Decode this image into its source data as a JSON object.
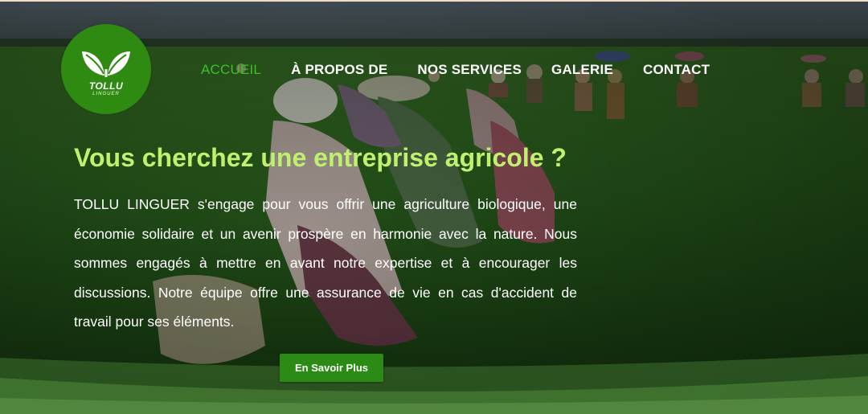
{
  "header": {
    "logo": {
      "title": "TOLLU",
      "subtitle": "LINGUER"
    },
    "nav": [
      {
        "label": "ACCUEIL",
        "active": true
      },
      {
        "label": "À PROPOS DE",
        "active": false
      },
      {
        "label": "NOS SERVICES",
        "active": false
      },
      {
        "label": "GALERIE",
        "active": false
      },
      {
        "label": "CONTACT",
        "active": false
      }
    ]
  },
  "hero": {
    "headline": "Vous cherchez une entreprise agricole ?",
    "description": "TOLLU LINGUER s'engage pour vous offrir une agriculture biologique, une économie solidaire et un avenir prospère en harmonie avec la nature. Nous sommes engagés à mettre en avant notre expertise et à encourager les discussions. Notre équipe offre une assurance de vie en cas d'accident de travail pour ses éléments.",
    "cta_label": "En Savoir Plus"
  },
  "colors": {
    "accent_green": "#2c8b14",
    "headline_lime": "#bff06e",
    "active_nav": "#3bbf2a"
  },
  "icons": {
    "logo_leaves": "leaves-icon"
  }
}
